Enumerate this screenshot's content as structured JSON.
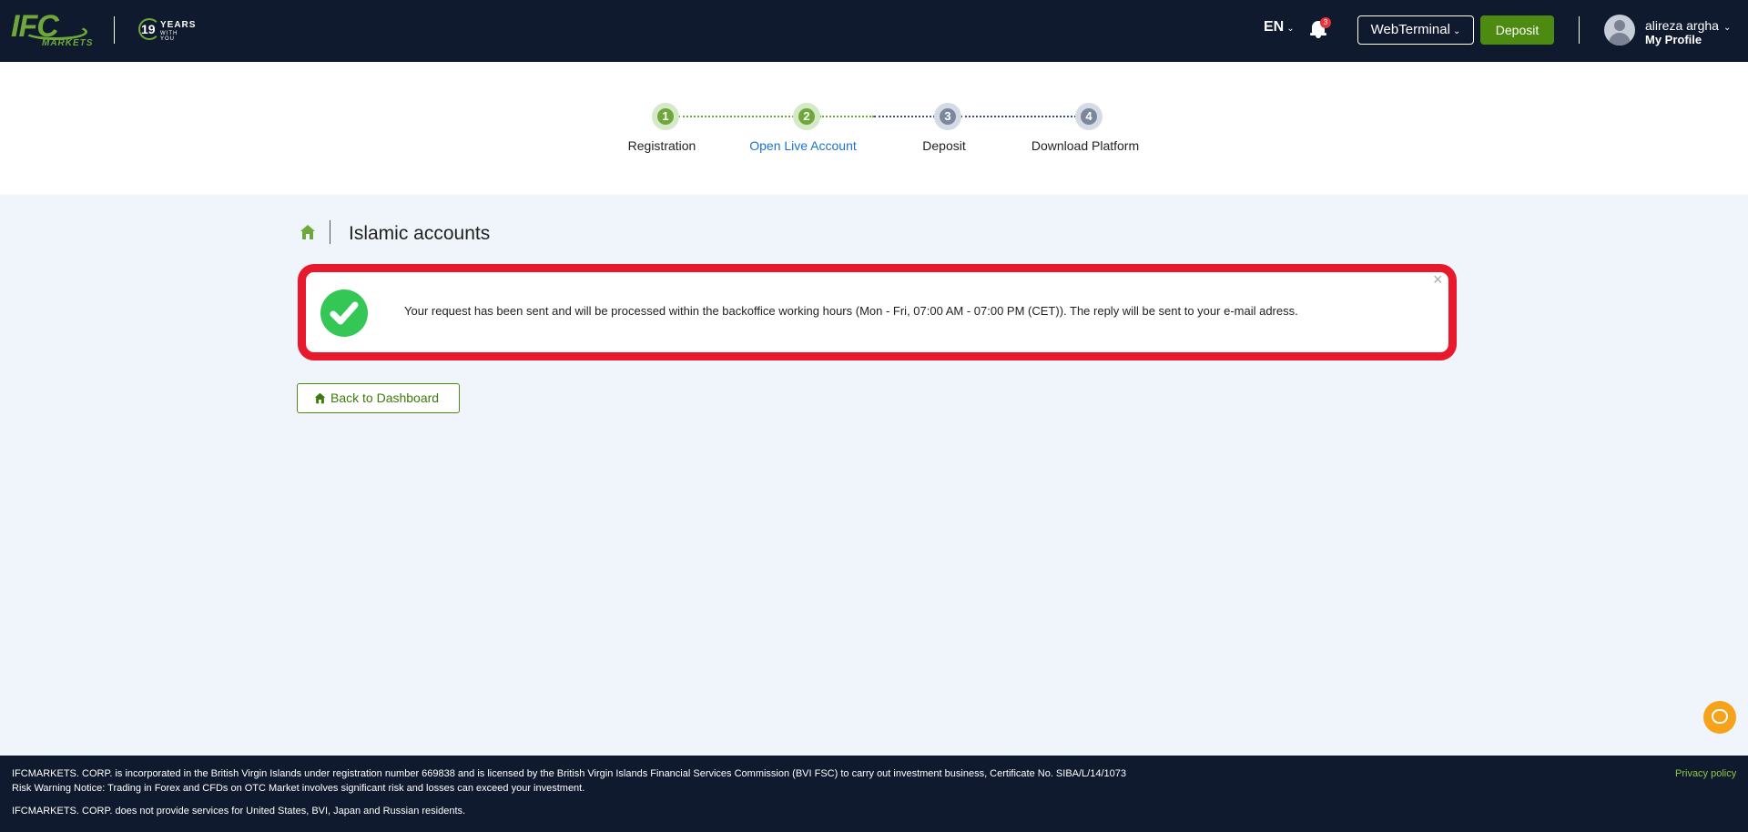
{
  "header": {
    "logo_text": "IFC",
    "logo_sub": "MARKETS",
    "years_number": "19",
    "years_label": "YEARS",
    "years_sub": "WITH YOU",
    "language": "EN",
    "notification_count": "3",
    "webterminal_label": "WebTerminal",
    "deposit_label": "Deposit",
    "user_name": "alireza argha",
    "profile_label": "My Profile",
    "brand_color": "#6fa83a",
    "bg_color": "#0f1a2e"
  },
  "stepper": {
    "steps": [
      {
        "number": "1",
        "label": "Registration",
        "status": "done"
      },
      {
        "number": "2",
        "label": "Open Live Account",
        "status": "current"
      },
      {
        "number": "3",
        "label": "Deposit",
        "status": "todo"
      },
      {
        "number": "4",
        "label": "Download Platform",
        "status": "todo"
      }
    ]
  },
  "page": {
    "title": "Islamic accounts",
    "home_icon": "home-icon"
  },
  "alert": {
    "message": "Your request has been sent and will be processed within the backoffice working hours (Mon - Fri, 07:00 AM - 07:00 PM (CET)). The reply will be sent to your e-mail adress.",
    "close_symbol": "×",
    "icon": "check-circle-icon",
    "border_color": "#e8192c"
  },
  "actions": {
    "back_label": "Back to Dashboard"
  },
  "footer": {
    "line1": "IFCMARKETS. CORP. is incorporated in the British Virgin Islands under registration number 669838 and is licensed by the British Virgin Islands Financial Services Commission (BVI FSC) to carry out investment business, Certificate No. SIBA/L/14/1073",
    "line2": "Risk Warning Notice: Trading in Forex and CFDs on OTC Market involves significant risk and losses can exceed your investment.",
    "line3": "IFCMARKETS. CORP. does not provide services for United States, BVI, Japan and Russian residents.",
    "privacy_label": "Privacy policy"
  }
}
